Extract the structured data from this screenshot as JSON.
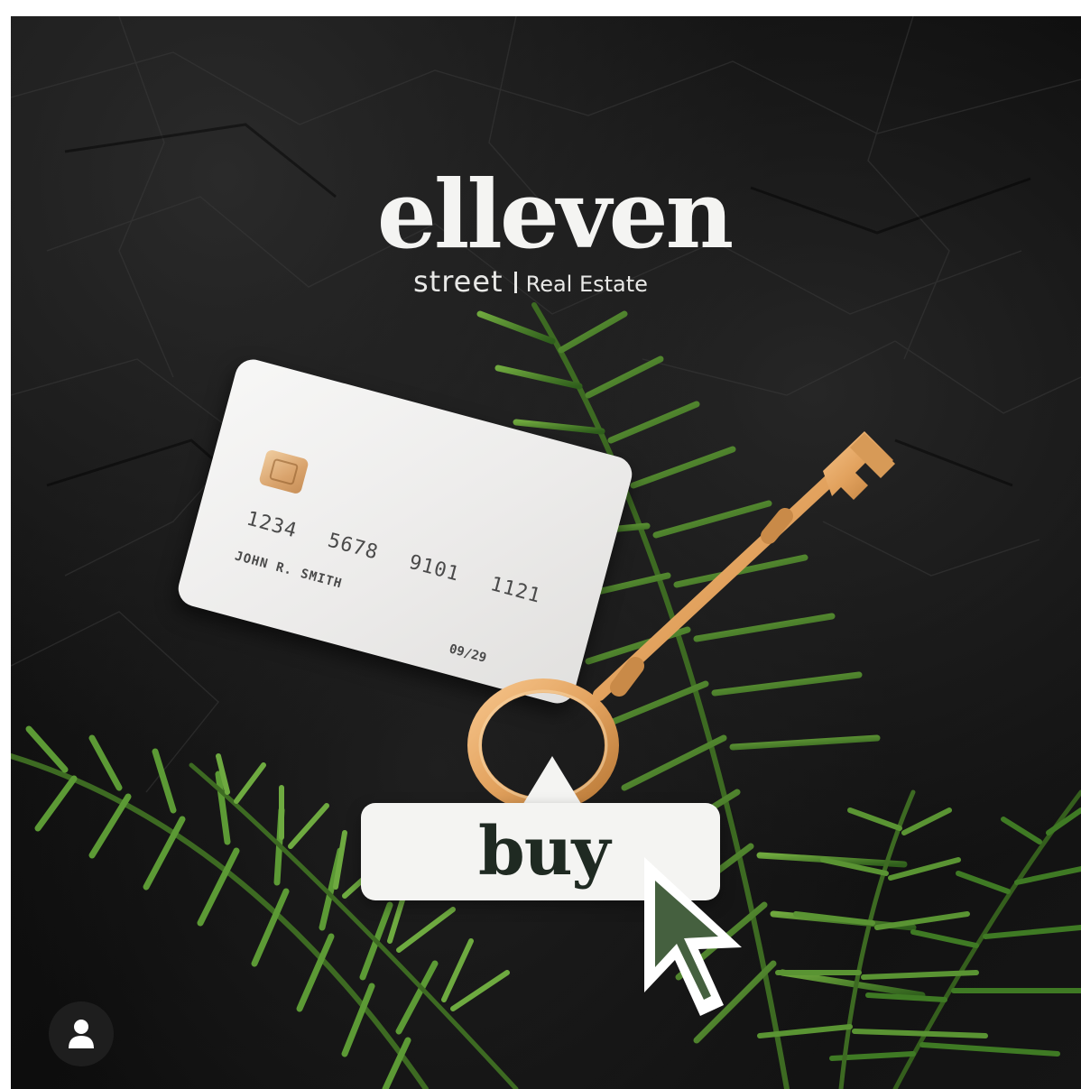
{
  "brand": {
    "name": "elleven",
    "sub_name": "street",
    "tagline": "Real Estate"
  },
  "card": {
    "number": "1234 5678 9101 1121",
    "holder": "JOHN R. SMITH",
    "expiry": "09/29"
  },
  "cta": {
    "label": "buy"
  },
  "icons": {
    "chip": "card-chip-icon",
    "key": "key-icon",
    "cursor": "cursor-arrow-icon",
    "user": "user-icon"
  },
  "colors": {
    "background": "#141414",
    "logo_text": "#f4f4f2",
    "button_bg": "#f4f4f2",
    "button_text": "#1f2a22",
    "cursor_fill": "#45603f",
    "key_gold": "#e2a25e",
    "frond_green": "#4f8a2e"
  }
}
